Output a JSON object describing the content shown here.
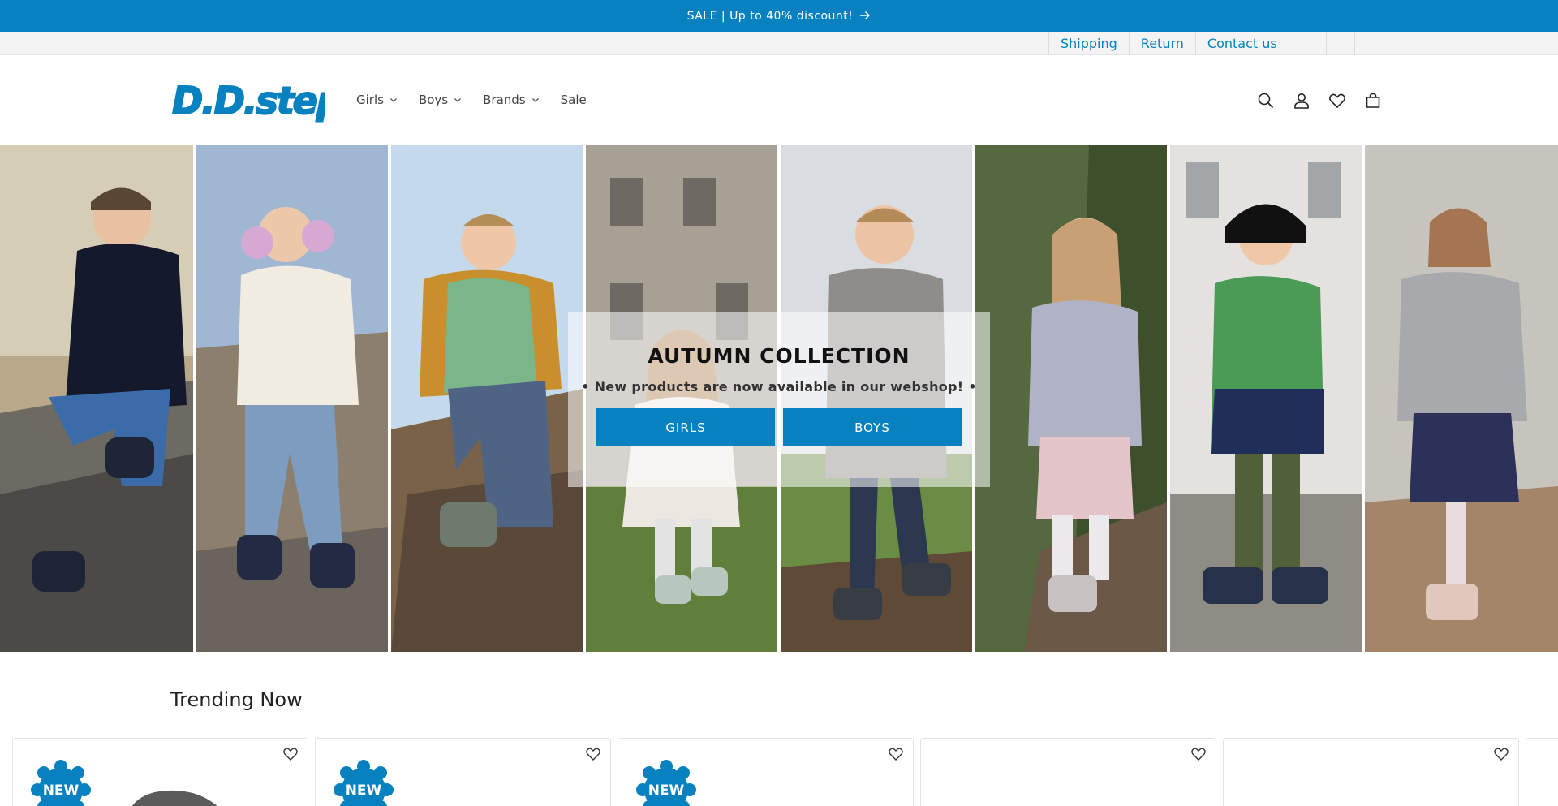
{
  "announcement": {
    "text": "SALE | Up to 40% discount!",
    "icon": "arrow-right-icon"
  },
  "utility_links": [
    {
      "label": "Shipping"
    },
    {
      "label": "Return"
    },
    {
      "label": "Contact us"
    }
  ],
  "brand": {
    "logo_text": "D.D.step",
    "color": "#0781bf"
  },
  "nav": [
    {
      "label": "Girls",
      "has_dropdown": true
    },
    {
      "label": "Boys",
      "has_dropdown": true
    },
    {
      "label": "Brands",
      "has_dropdown": true
    },
    {
      "label": "Sale",
      "has_dropdown": false
    }
  ],
  "header_icons": [
    "search-icon",
    "account-icon",
    "wishlist-icon",
    "cart-icon"
  ],
  "hero": {
    "title": "AUTUMN COLLECTION",
    "subtitle": "• New products are now available in our webshop! •",
    "buttons": [
      {
        "label": "GIRLS"
      },
      {
        "label": "BOYS"
      }
    ]
  },
  "trending": {
    "title": "Trending Now",
    "badge_text": "NEW",
    "products": [
      {
        "badge": true
      },
      {
        "badge": true
      },
      {
        "badge": true
      },
      {
        "badge": false
      },
      {
        "badge": false
      }
    ]
  },
  "colors": {
    "accent": "#0781bf",
    "utility_bg": "#f4f4f4"
  }
}
